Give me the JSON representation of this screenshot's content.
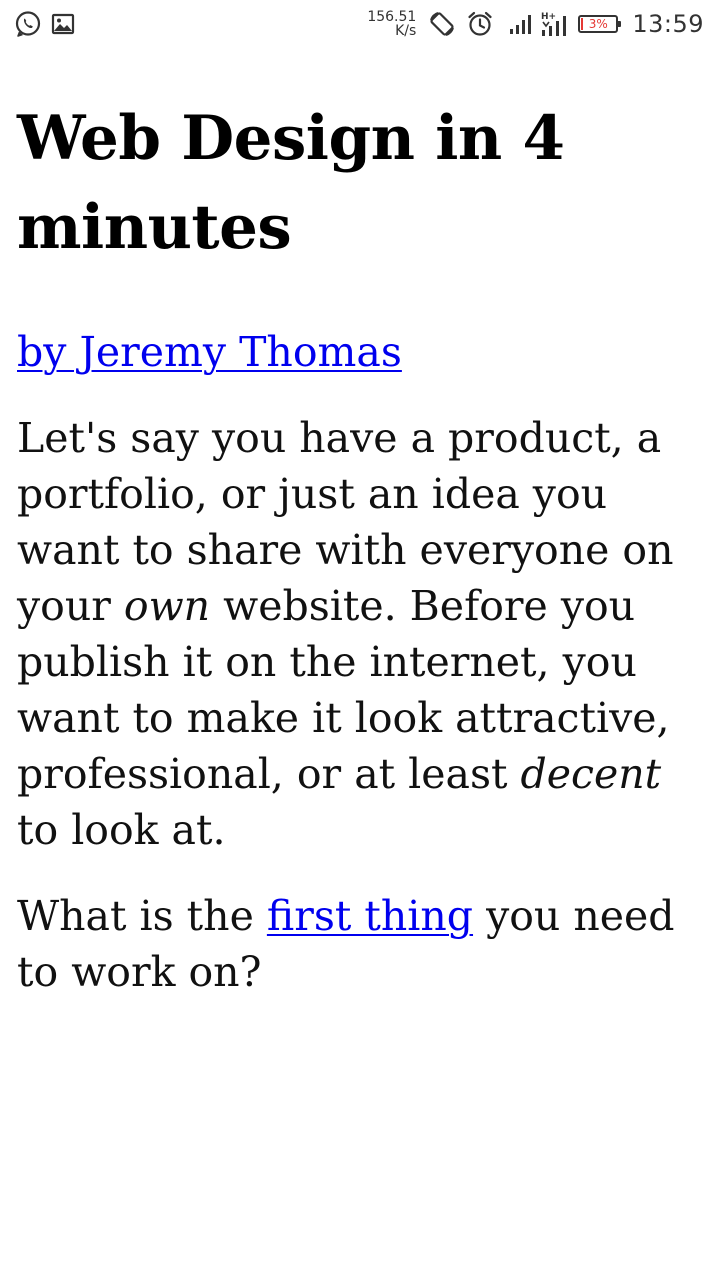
{
  "status_bar": {
    "left_icons": [
      "whatsapp-icon",
      "gallery-icon"
    ],
    "net_speed_value": "156.51",
    "net_speed_unit": "K/s",
    "right_icons": [
      "auto-rotate-icon",
      "alarm-icon",
      "signal-icon",
      "signal-4g-icon"
    ],
    "battery_percent": "3%",
    "battery_level": 0.03,
    "battery_color": "#e53935",
    "time": "13:59"
  },
  "article": {
    "title": "Web Design in 4 minutes",
    "author_link": "by Jeremy Thomas",
    "paragraph1": {
      "part1": "Let's say you have a product, a portfolio, or just an idea you want to share with everyone on your ",
      "em1": "own",
      "part2": " website. Before you publish it on the internet, you want to make it look attractive, professional, or at least ",
      "em2": "decent",
      "part3": " to look at."
    },
    "paragraph2": {
      "part1": "What is the ",
      "link": "first thing",
      "part2": " you need to work on?"
    }
  },
  "colors": {
    "link": "#0000ee",
    "text": "#111111",
    "background": "#ffffff"
  }
}
